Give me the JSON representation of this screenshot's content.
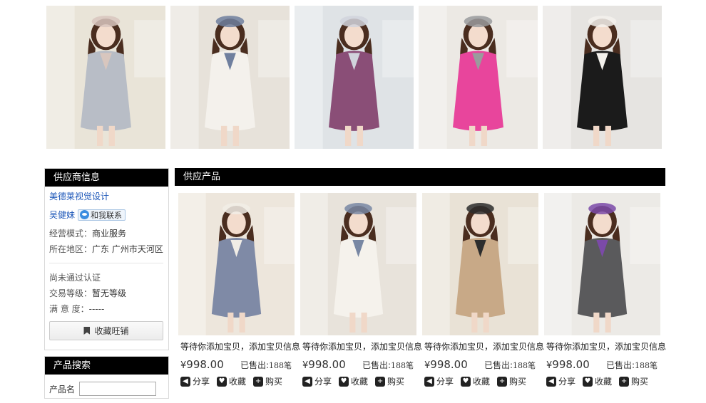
{
  "gallery": {
    "images": [
      {
        "name": "model-grey-lace-dress-photo",
        "bg": "#e9e4d8",
        "coat": "#b8bdc6",
        "accent": "#d8c6be"
      },
      {
        "name": "model-white-fleece-coat-photo",
        "bg": "#e7e2da",
        "coat": "#f4f1ec",
        "accent": "#6f7f9e"
      },
      {
        "name": "model-plaid-coat-photo",
        "bg": "#dfe3e6",
        "coat": "#8a4e77",
        "accent": "#d1d3dc"
      },
      {
        "name": "model-pink-coat-photo",
        "bg": "#ece9e4",
        "coat": "#e8459c",
        "accent": "#9a9b9d"
      },
      {
        "name": "model-black-white-dress-photo",
        "bg": "#e6e4e1",
        "coat": "#1b1b1b",
        "accent": "#f3f1ec"
      }
    ]
  },
  "supplier": {
    "header": "供应商信息",
    "company": "美德莱视觉设计",
    "username": "吴健妹",
    "contact_label": "和我联系",
    "mode_label": "经营模式：",
    "mode_value": "商业服务",
    "region_label": "所在地区：",
    "region_value": "广东 广州市天河区",
    "cert_status": "尚未通过认证",
    "level_label": "交易等级：",
    "level_value": "暂无等级",
    "satisfaction_label": "满 意 度：",
    "satisfaction_value": "-----",
    "fav_store_label": "收藏旺铺"
  },
  "search": {
    "header": "产品搜索",
    "field_label": "产品名"
  },
  "products": {
    "header": "供应产品",
    "items": [
      {
        "title": "等待你添加宝贝，添加宝贝信息",
        "currency": "¥",
        "price": "998.00",
        "sold_label": "已售出:",
        "sold_count": "188笔",
        "bg": "#ede6dc",
        "coat": "#7f8aa6",
        "accent": "#f1ede6"
      },
      {
        "title": "等待你添加宝贝，添加宝贝信息",
        "currency": "¥",
        "price": "998.00",
        "sold_label": "已售出:",
        "sold_count": "188笔",
        "bg": "#e8e3db",
        "coat": "#f5f2ec",
        "accent": "#7887a3"
      },
      {
        "title": "等待你添加宝贝，添加宝贝信息",
        "currency": "¥",
        "price": "998.00",
        "sold_label": "已售出:",
        "sold_count": "188笔",
        "bg": "#e9e2d6",
        "coat": "#c8a987",
        "accent": "#2d2d2d"
      },
      {
        "title": "等待你添加宝贝，添加宝贝信息",
        "currency": "¥",
        "price": "998.00",
        "sold_label": "已售出:",
        "sold_count": "188笔",
        "bg": "#eceae6",
        "coat": "#5a5a5c",
        "accent": "#7b4aa8"
      }
    ],
    "actions": {
      "share": "分享",
      "favorite": "收藏",
      "buy": "购买"
    }
  },
  "icons": {
    "share": "share-icon",
    "favorite": "heart-icon",
    "buy": "plus-icon",
    "bookmark": "bookmark-icon",
    "contact": "aliwangwang-icon"
  }
}
